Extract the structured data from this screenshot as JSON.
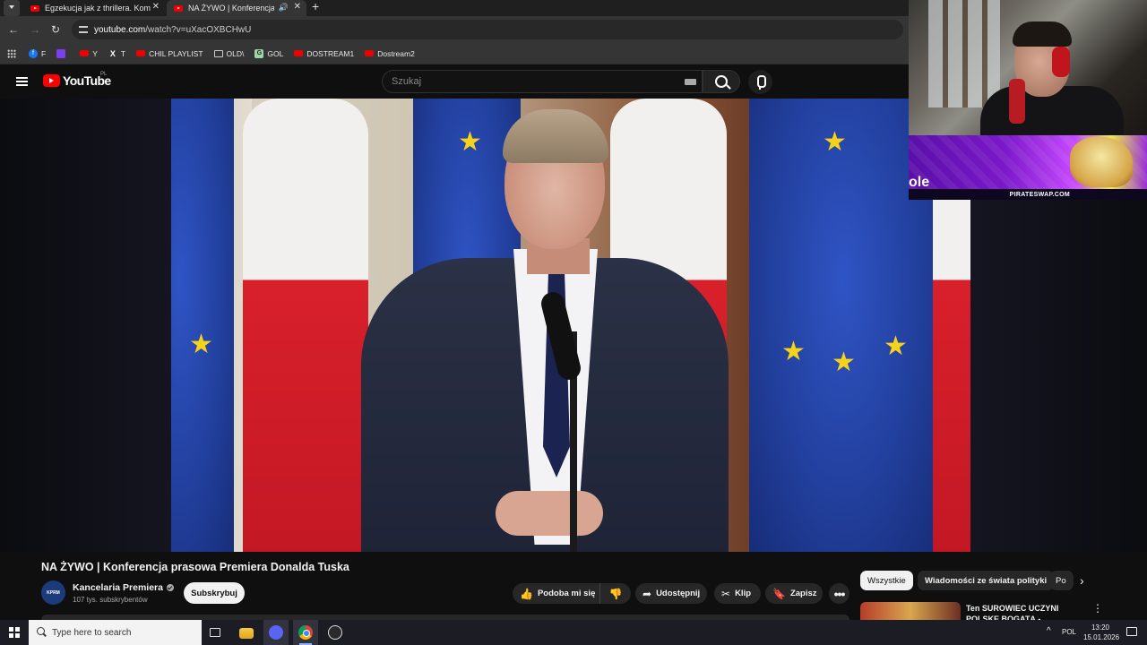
{
  "browser": {
    "tabs": [
      {
        "title": "Egzekucja jak z thrillera. Komor",
        "active": false
      },
      {
        "title": "NA ŻYWO | Konferencja pra",
        "active": true,
        "audio": true
      }
    ],
    "url_prefix": "youtube.com",
    "url_rest": "/watch?v=uXacOXBCHwU",
    "bookmarks": [
      {
        "label": "F",
        "icon": "facebook-icon"
      },
      {
        "label": "",
        "icon": "twitch-icon"
      },
      {
        "label": "Y",
        "icon": "youtube-icon"
      },
      {
        "label": "T",
        "icon": "x-icon"
      },
      {
        "label": "CHIL PLAYLIST",
        "icon": "youtube-icon"
      },
      {
        "label": "OLD\\",
        "icon": "folder-icon"
      },
      {
        "label": "GOL",
        "icon": "g-icon"
      },
      {
        "label": "DOSTREAM1",
        "icon": "youtube-icon"
      },
      {
        "label": "Dostream2",
        "icon": "youtube-icon"
      }
    ]
  },
  "youtube": {
    "logo_text": "YouTube",
    "country": "PL",
    "search_placeholder": "Szukaj",
    "video_title": "NA ŻYWO | Konferencja prasowa Premiera Donalda Tuska",
    "channel": {
      "name": "Kancelaria Premiera",
      "avatar_text": "KPRM",
      "subscribers": "107 tys. subskrybentów",
      "subscribe_label": "Subskrybuj"
    },
    "actions": {
      "like": "Podoba mi się",
      "share": "Udostępnij",
      "clip": "Klip",
      "save": "Zapisz",
      "more": "•••"
    },
    "chips": [
      "Wszystkie",
      "Wiadomości ze świata polityki",
      "Po"
    ],
    "recommendation": {
      "title": "Ten SUROWIEC UCZYNI POLSKĘ BOGATĄ - Niesłychan"
    }
  },
  "overlay": {
    "banner_text": "PIRATESWAP.COM",
    "banner_partial": "ole"
  },
  "taskbar": {
    "search_placeholder": "Type here to search",
    "lang": "POL",
    "time": "13:20",
    "date": "15.01.2026"
  }
}
